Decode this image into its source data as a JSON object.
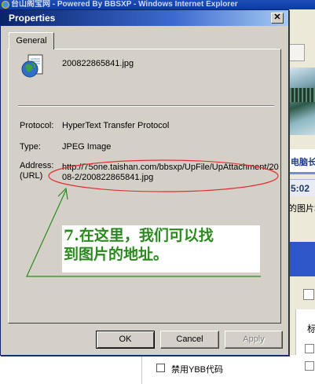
{
  "browser": {
    "title": "台山阁宝网 - Powered By BBSXP - Windows Internet Explorer",
    "banner_heading": "电脑长",
    "clock": "5:02",
    "text_snippet": "的图片地",
    "form_label": "标",
    "ybb_label": "禁用YBB代码"
  },
  "dialog": {
    "title": "Properties",
    "close_label": "✕",
    "tab_label": "General",
    "filename": "200822865841.jpg",
    "protocol_label": "Protocol:",
    "protocol_value": "HyperText Transfer Protocol",
    "type_label": "Type:",
    "type_value": "JPEG Image",
    "address_label": "Address:",
    "url_label": "(URL)",
    "address_value": "http://75one.taishan.com/bbsxp/UpFile/UpAttachment/2008-2/200822865841.jpg",
    "annotation_line1": "7.在这里，我们可以找",
    "annotation_line2": "到图片的地址。",
    "buttons": {
      "ok": "OK",
      "cancel": "Cancel",
      "apply": "Apply"
    }
  },
  "colors": {
    "annotation_text": "#2a8a1e",
    "annotation_ellipse": "#e23030",
    "annotation_arrow": "#2a8a1e"
  }
}
